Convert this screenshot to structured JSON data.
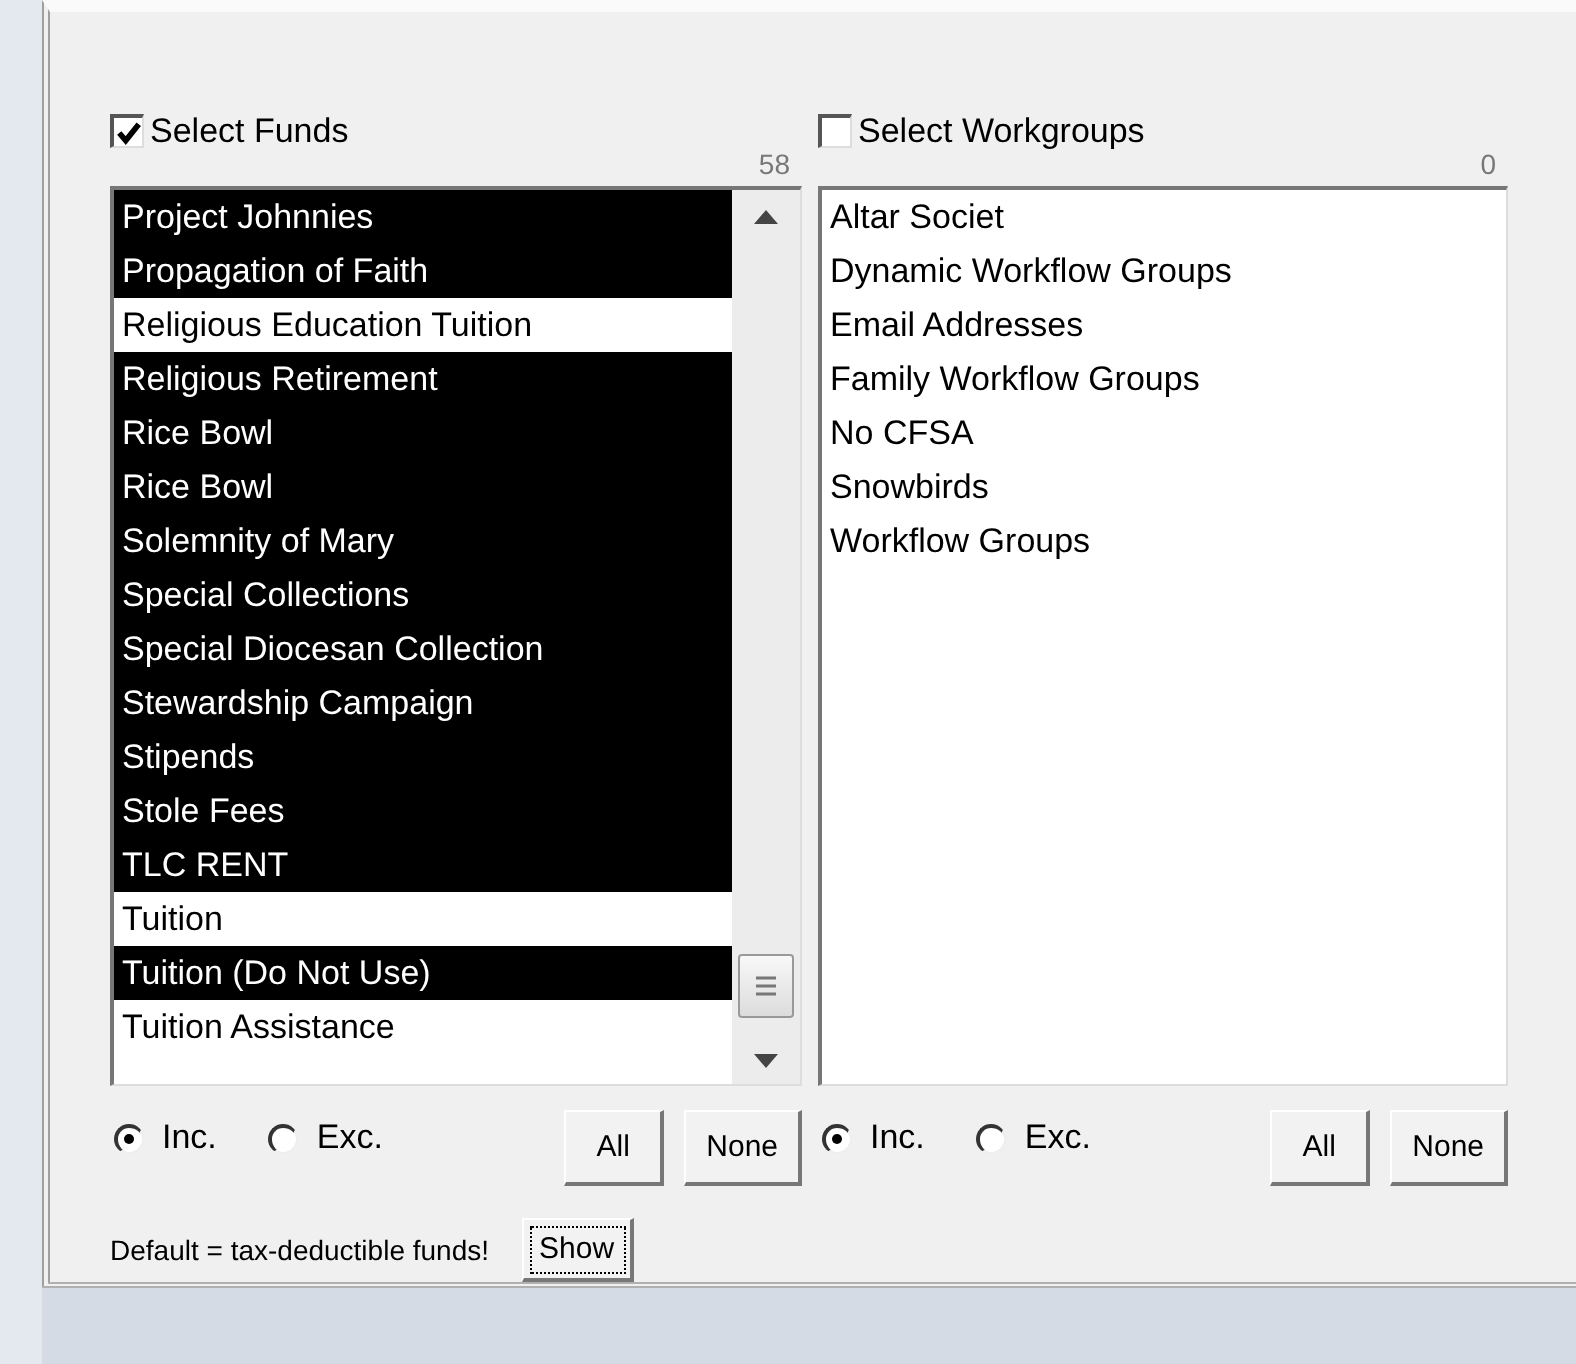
{
  "panels": [
    {
      "label": "Select Funds",
      "checked": true,
      "count": "58",
      "scrollbar": true,
      "items": [
        {
          "text": "Project Johnnies",
          "selected": true
        },
        {
          "text": "Propagation of Faith",
          "selected": true
        },
        {
          "text": "Religious Education Tuition",
          "selected": false
        },
        {
          "text": "Religious Retirement",
          "selected": true
        },
        {
          "text": "Rice Bowl",
          "selected": true
        },
        {
          "text": "Rice Bowl",
          "selected": true
        },
        {
          "text": "Solemnity of Mary",
          "selected": true
        },
        {
          "text": "Special Collections",
          "selected": true
        },
        {
          "text": "Special Diocesan Collection",
          "selected": true
        },
        {
          "text": "Stewardship Campaign",
          "selected": true
        },
        {
          "text": "Stipends",
          "selected": true
        },
        {
          "text": "Stole Fees",
          "selected": true
        },
        {
          "text": "TLC RENT",
          "selected": true
        },
        {
          "text": "Tuition",
          "selected": false
        },
        {
          "text": "Tuition (Do Not Use)",
          "selected": true
        },
        {
          "text": "Tuition Assistance",
          "selected": false
        }
      ],
      "options": [
        {
          "label": "Inc.",
          "selected": true
        },
        {
          "label": "Exc.",
          "selected": false
        }
      ],
      "buttons": [
        "All",
        "None"
      ]
    },
    {
      "label": "Select Workgroups",
      "checked": false,
      "count": "0",
      "scrollbar": false,
      "items": [
        {
          "text": "Altar Societ",
          "selected": false
        },
        {
          "text": "Dynamic Workflow Groups",
          "selected": false
        },
        {
          "text": "Email Addresses",
          "selected": false
        },
        {
          "text": "Family Workflow Groups",
          "selected": false
        },
        {
          "text": "No CFSA",
          "selected": false
        },
        {
          "text": "Snowbirds",
          "selected": false
        },
        {
          "text": "Workflow Groups",
          "selected": false
        }
      ],
      "options": [
        {
          "label": "Inc.",
          "selected": true
        },
        {
          "label": "Exc.",
          "selected": false
        }
      ],
      "buttons": [
        "All",
        "None"
      ]
    }
  ],
  "footer": {
    "note": "Default = tax-deductible funds!",
    "button": "Show"
  }
}
